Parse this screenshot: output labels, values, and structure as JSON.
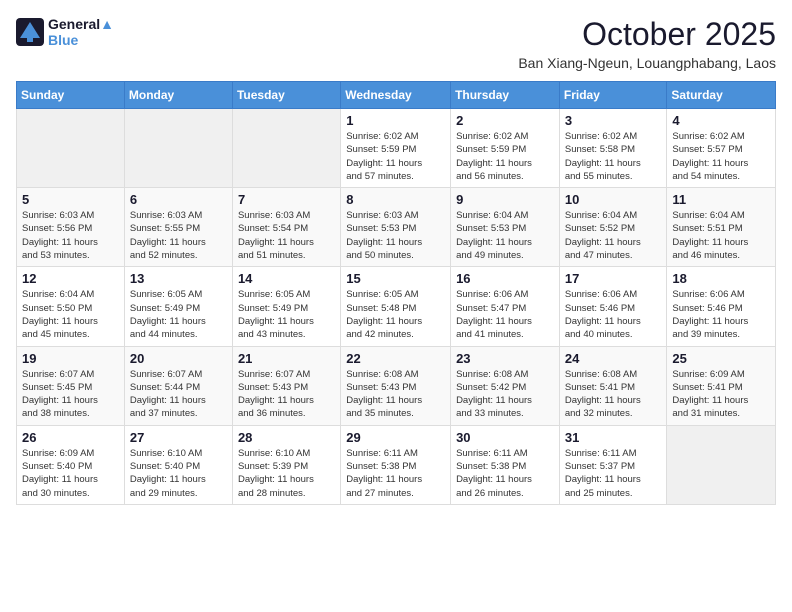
{
  "logo": {
    "line1": "General",
    "line2": "Blue"
  },
  "title": "October 2025",
  "location": "Ban Xiang-Ngeun, Louangphabang, Laos",
  "days_of_week": [
    "Sunday",
    "Monday",
    "Tuesday",
    "Wednesday",
    "Thursday",
    "Friday",
    "Saturday"
  ],
  "weeks": [
    [
      {
        "num": "",
        "info": ""
      },
      {
        "num": "",
        "info": ""
      },
      {
        "num": "",
        "info": ""
      },
      {
        "num": "1",
        "info": "Sunrise: 6:02 AM\nSunset: 5:59 PM\nDaylight: 11 hours\nand 57 minutes."
      },
      {
        "num": "2",
        "info": "Sunrise: 6:02 AM\nSunset: 5:59 PM\nDaylight: 11 hours\nand 56 minutes."
      },
      {
        "num": "3",
        "info": "Sunrise: 6:02 AM\nSunset: 5:58 PM\nDaylight: 11 hours\nand 55 minutes."
      },
      {
        "num": "4",
        "info": "Sunrise: 6:02 AM\nSunset: 5:57 PM\nDaylight: 11 hours\nand 54 minutes."
      }
    ],
    [
      {
        "num": "5",
        "info": "Sunrise: 6:03 AM\nSunset: 5:56 PM\nDaylight: 11 hours\nand 53 minutes."
      },
      {
        "num": "6",
        "info": "Sunrise: 6:03 AM\nSunset: 5:55 PM\nDaylight: 11 hours\nand 52 minutes."
      },
      {
        "num": "7",
        "info": "Sunrise: 6:03 AM\nSunset: 5:54 PM\nDaylight: 11 hours\nand 51 minutes."
      },
      {
        "num": "8",
        "info": "Sunrise: 6:03 AM\nSunset: 5:53 PM\nDaylight: 11 hours\nand 50 minutes."
      },
      {
        "num": "9",
        "info": "Sunrise: 6:04 AM\nSunset: 5:53 PM\nDaylight: 11 hours\nand 49 minutes."
      },
      {
        "num": "10",
        "info": "Sunrise: 6:04 AM\nSunset: 5:52 PM\nDaylight: 11 hours\nand 47 minutes."
      },
      {
        "num": "11",
        "info": "Sunrise: 6:04 AM\nSunset: 5:51 PM\nDaylight: 11 hours\nand 46 minutes."
      }
    ],
    [
      {
        "num": "12",
        "info": "Sunrise: 6:04 AM\nSunset: 5:50 PM\nDaylight: 11 hours\nand 45 minutes."
      },
      {
        "num": "13",
        "info": "Sunrise: 6:05 AM\nSunset: 5:49 PM\nDaylight: 11 hours\nand 44 minutes."
      },
      {
        "num": "14",
        "info": "Sunrise: 6:05 AM\nSunset: 5:49 PM\nDaylight: 11 hours\nand 43 minutes."
      },
      {
        "num": "15",
        "info": "Sunrise: 6:05 AM\nSunset: 5:48 PM\nDaylight: 11 hours\nand 42 minutes."
      },
      {
        "num": "16",
        "info": "Sunrise: 6:06 AM\nSunset: 5:47 PM\nDaylight: 11 hours\nand 41 minutes."
      },
      {
        "num": "17",
        "info": "Sunrise: 6:06 AM\nSunset: 5:46 PM\nDaylight: 11 hours\nand 40 minutes."
      },
      {
        "num": "18",
        "info": "Sunrise: 6:06 AM\nSunset: 5:46 PM\nDaylight: 11 hours\nand 39 minutes."
      }
    ],
    [
      {
        "num": "19",
        "info": "Sunrise: 6:07 AM\nSunset: 5:45 PM\nDaylight: 11 hours\nand 38 minutes."
      },
      {
        "num": "20",
        "info": "Sunrise: 6:07 AM\nSunset: 5:44 PM\nDaylight: 11 hours\nand 37 minutes."
      },
      {
        "num": "21",
        "info": "Sunrise: 6:07 AM\nSunset: 5:43 PM\nDaylight: 11 hours\nand 36 minutes."
      },
      {
        "num": "22",
        "info": "Sunrise: 6:08 AM\nSunset: 5:43 PM\nDaylight: 11 hours\nand 35 minutes."
      },
      {
        "num": "23",
        "info": "Sunrise: 6:08 AM\nSunset: 5:42 PM\nDaylight: 11 hours\nand 33 minutes."
      },
      {
        "num": "24",
        "info": "Sunrise: 6:08 AM\nSunset: 5:41 PM\nDaylight: 11 hours\nand 32 minutes."
      },
      {
        "num": "25",
        "info": "Sunrise: 6:09 AM\nSunset: 5:41 PM\nDaylight: 11 hours\nand 31 minutes."
      }
    ],
    [
      {
        "num": "26",
        "info": "Sunrise: 6:09 AM\nSunset: 5:40 PM\nDaylight: 11 hours\nand 30 minutes."
      },
      {
        "num": "27",
        "info": "Sunrise: 6:10 AM\nSunset: 5:40 PM\nDaylight: 11 hours\nand 29 minutes."
      },
      {
        "num": "28",
        "info": "Sunrise: 6:10 AM\nSunset: 5:39 PM\nDaylight: 11 hours\nand 28 minutes."
      },
      {
        "num": "29",
        "info": "Sunrise: 6:11 AM\nSunset: 5:38 PM\nDaylight: 11 hours\nand 27 minutes."
      },
      {
        "num": "30",
        "info": "Sunrise: 6:11 AM\nSunset: 5:38 PM\nDaylight: 11 hours\nand 26 minutes."
      },
      {
        "num": "31",
        "info": "Sunrise: 6:11 AM\nSunset: 5:37 PM\nDaylight: 11 hours\nand 25 minutes."
      },
      {
        "num": "",
        "info": ""
      }
    ]
  ]
}
